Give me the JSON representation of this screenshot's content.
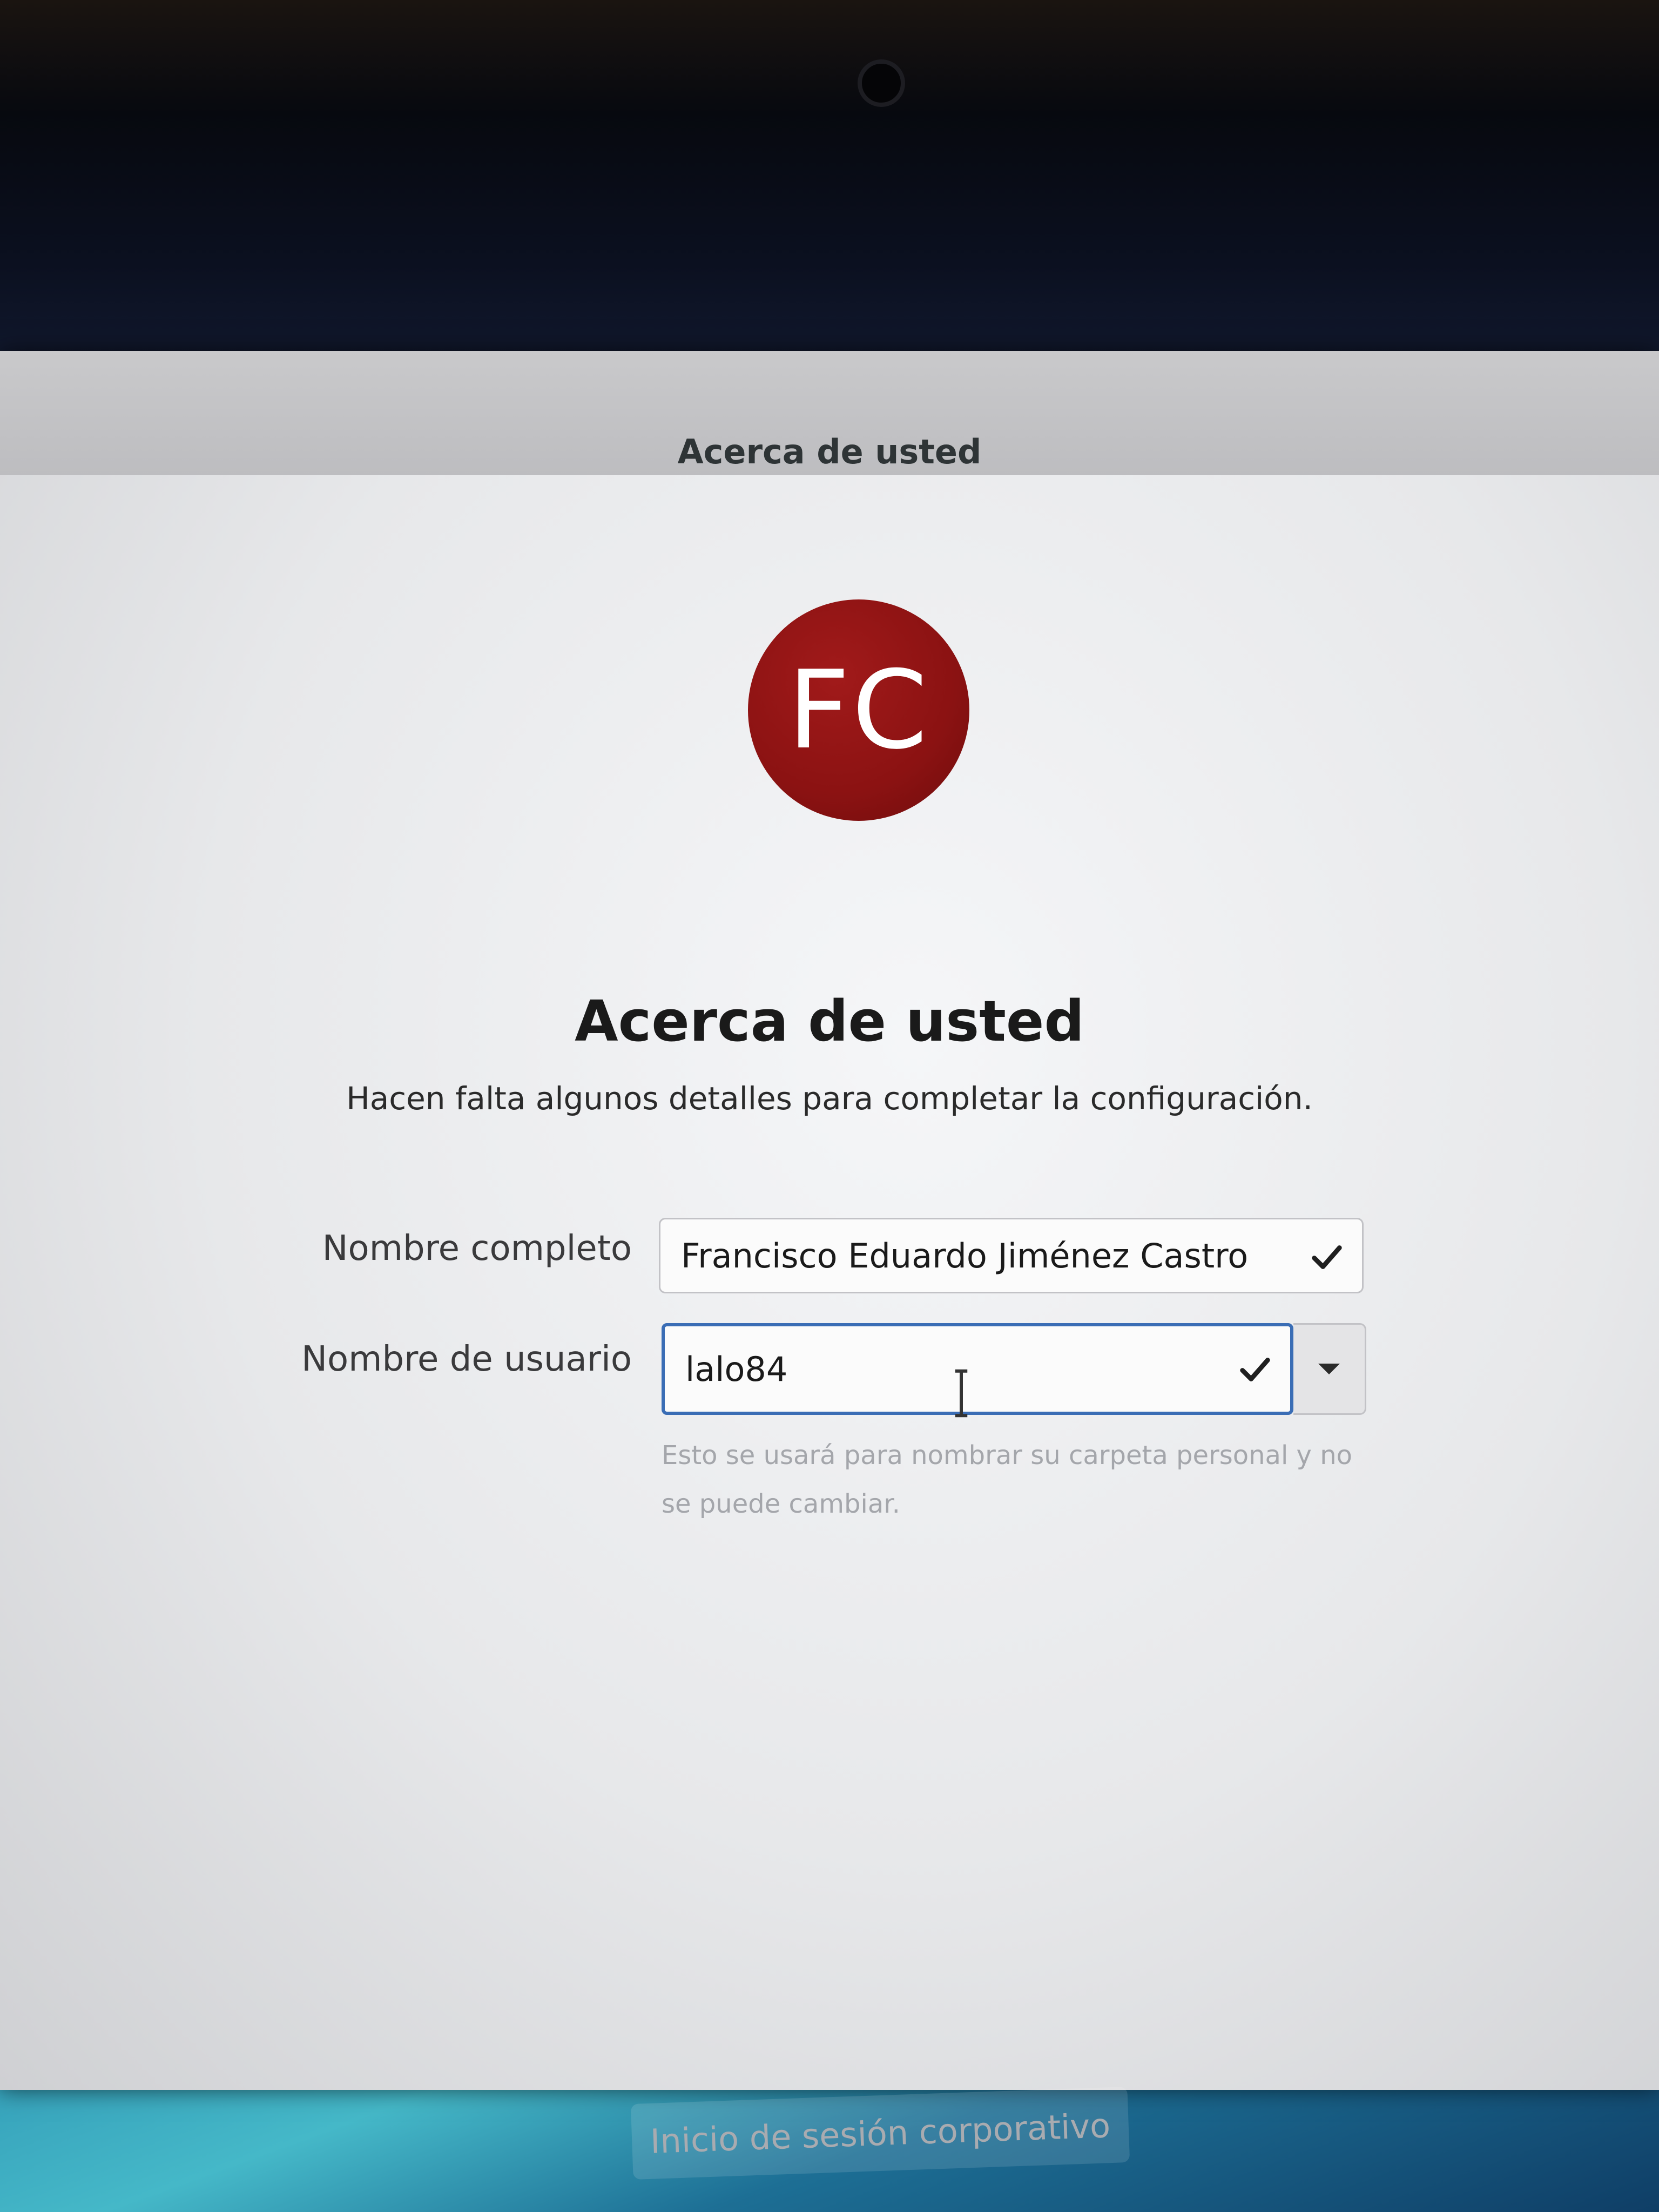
{
  "window": {
    "title": "Acerca de usted"
  },
  "avatar": {
    "initials": "FC",
    "color": "#8b1212"
  },
  "page": {
    "title": "Acerca de usted",
    "subtitle": "Hacen falta algunos detalles para completar la configuración."
  },
  "form": {
    "full_name": {
      "label": "Nombre completo",
      "value": "Francisco Eduardo Jiménez Castro",
      "status_icon": "check-icon"
    },
    "username": {
      "label": "Nombre de usuario",
      "value": "lalo84",
      "status_icon": "check-icon",
      "hint": "Esto se usará para nombrar su carpeta personal y no se puede cambiar."
    }
  },
  "enterprise_login": {
    "label": "Inicio de sesión corporativo"
  },
  "colors": {
    "focus_border": "#3a6db5",
    "hint_text": "#a4a6ab"
  }
}
